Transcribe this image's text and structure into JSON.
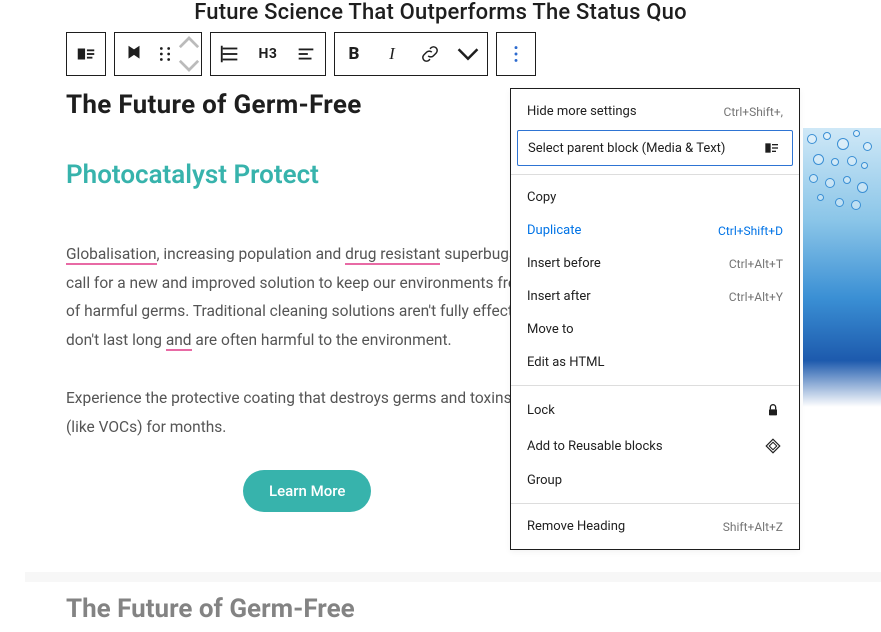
{
  "page": {
    "title": "Future Science That Outperforms The Status Quo"
  },
  "toolbar": {
    "heading_level": "H3",
    "bold": "B",
    "italic": "I"
  },
  "content": {
    "heading1": "The Future of Germ-Free",
    "heading2": "Photocatalyst Protect",
    "para1_pre": "Globalisation",
    "para1_mid1": ", increasing population and ",
    "para1_drug": "drug resistant",
    "para1_mid2": " superbugs call for a new and improved solution to keep our environments free of harmful germs. Traditional cleaning solutions aren't fully effective, don't last long ",
    "para1_and": "and",
    "para1_mid3": " are often harmful to the environment.",
    "para2": "Experience the protective coating that destroys germs and toxins (like VOCs) for months.",
    "cta": "Learn More",
    "heading3": "The Future of Germ-Free"
  },
  "menu": {
    "hide": {
      "label": "Hide more settings",
      "short": "Ctrl+Shift+,"
    },
    "parent": {
      "label": "Select parent block (Media & Text)"
    },
    "copy": {
      "label": "Copy"
    },
    "dup": {
      "label": "Duplicate",
      "short": "Ctrl+Shift+D"
    },
    "before": {
      "label": "Insert before",
      "short": "Ctrl+Alt+T"
    },
    "after": {
      "label": "Insert after",
      "short": "Ctrl+Alt+Y"
    },
    "move": {
      "label": "Move to"
    },
    "html": {
      "label": "Edit as HTML"
    },
    "lock": {
      "label": "Lock"
    },
    "reusable": {
      "label": "Add to Reusable blocks"
    },
    "group": {
      "label": "Group"
    },
    "remove": {
      "label": "Remove Heading",
      "short": "Shift+Alt+Z"
    }
  }
}
